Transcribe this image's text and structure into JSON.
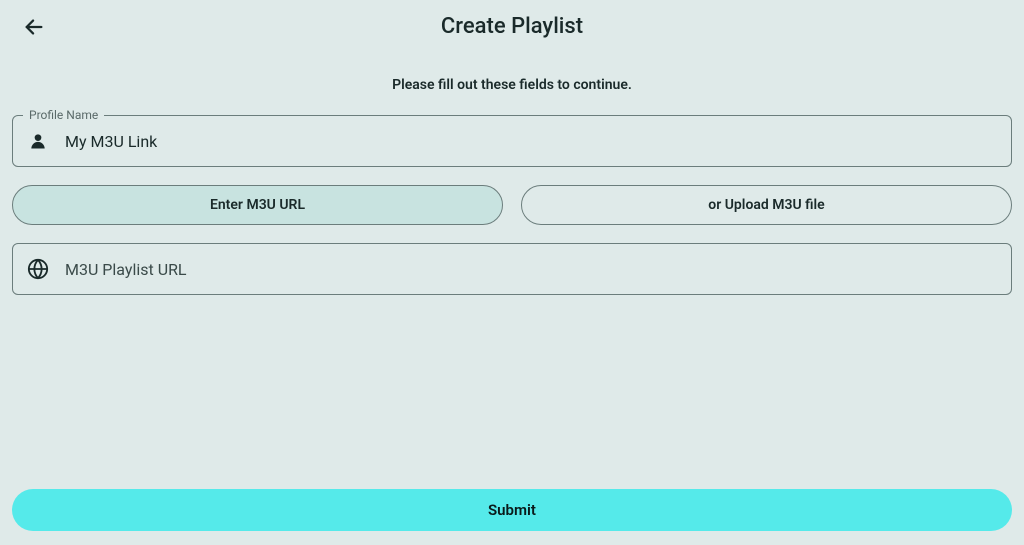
{
  "header": {
    "title": "Create Playlist"
  },
  "instruction": "Please fill out these fields to continue.",
  "profileName": {
    "legend": "Profile Name",
    "value": "My M3U Link"
  },
  "toggles": {
    "enterUrl": "Enter M3U URL",
    "uploadFile": "or Upload M3U file"
  },
  "urlField": {
    "placeholder": "M3U Playlist URL",
    "value": ""
  },
  "submit": {
    "label": "Submit"
  }
}
